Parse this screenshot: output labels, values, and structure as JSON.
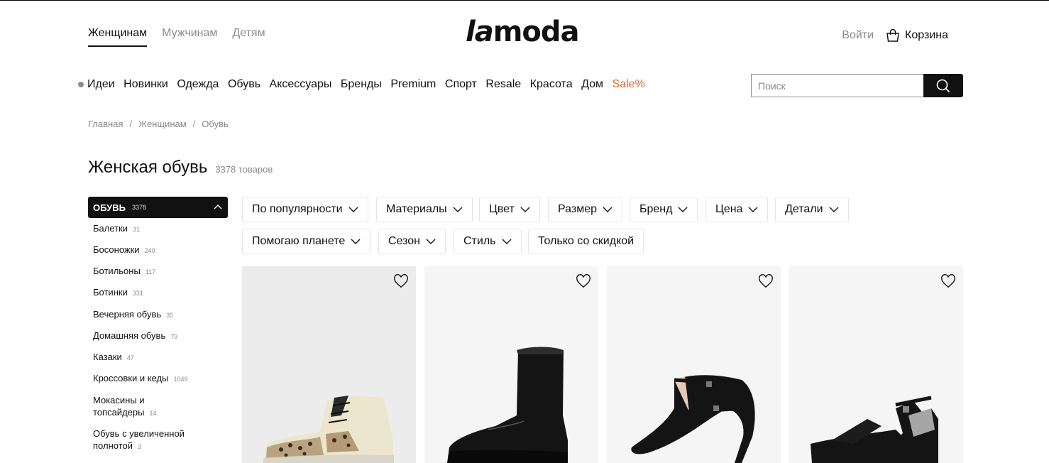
{
  "header": {
    "gender_tabs": [
      {
        "label": "Женщинам",
        "active": true
      },
      {
        "label": "Мужчинам",
        "active": false
      },
      {
        "label": "Детям",
        "active": false
      }
    ],
    "logo": {
      "part1": "la",
      "part2": "moda"
    },
    "login_label": "Войти",
    "cart_label": "Корзина"
  },
  "category_nav": {
    "items": [
      "Идеи",
      "Новинки",
      "Одежда",
      "Обувь",
      "Аксессуары",
      "Бренды",
      "Premium",
      "Спорт",
      "Resale",
      "Красота",
      "Дом"
    ],
    "sale_label": "Sale%",
    "sale_color": "#d46a3e"
  },
  "search": {
    "placeholder": "Поиск",
    "value": ""
  },
  "breadcrumb": {
    "items": [
      "Главная",
      "Женщинам",
      "Обувь"
    ],
    "separator": "/"
  },
  "page": {
    "title": "Женская обувь",
    "count": "3378 товаров"
  },
  "sidebar": {
    "head_label": "ОБУВЬ",
    "head_count": "3378",
    "items": [
      {
        "label": "Балетки",
        "count": "31"
      },
      {
        "label": "Босоножки",
        "count": "240"
      },
      {
        "label": "Ботильоны",
        "count": "117"
      },
      {
        "label": "Ботинки",
        "count": "331"
      },
      {
        "label": "Вечерняя обувь",
        "count": "35"
      },
      {
        "label": "Домашняя обувь",
        "count": "79"
      },
      {
        "label": "Казаки",
        "count": "47"
      },
      {
        "label": "Кроссовки и кеды",
        "count": "1049"
      },
      {
        "label": "Мокасины и топсайдеры",
        "count": "14"
      },
      {
        "label": "Обувь с увеличенной полнотой",
        "count": "3"
      }
    ]
  },
  "filters": {
    "row1": [
      "По популярности",
      "Материалы",
      "Цвет",
      "Размер",
      "Бренд",
      "Цена",
      "Детали"
    ],
    "row2": [
      "Помогаю планете",
      "Сезон",
      "Стиль"
    ],
    "discount_label": "Только со скидкой"
  },
  "products": [
    {
      "icon": "sneaker-leopard-image"
    },
    {
      "icon": "platform-boot-image"
    },
    {
      "icon": "heeled-sandal-image"
    },
    {
      "icon": "platform-sandal-image"
    }
  ]
}
